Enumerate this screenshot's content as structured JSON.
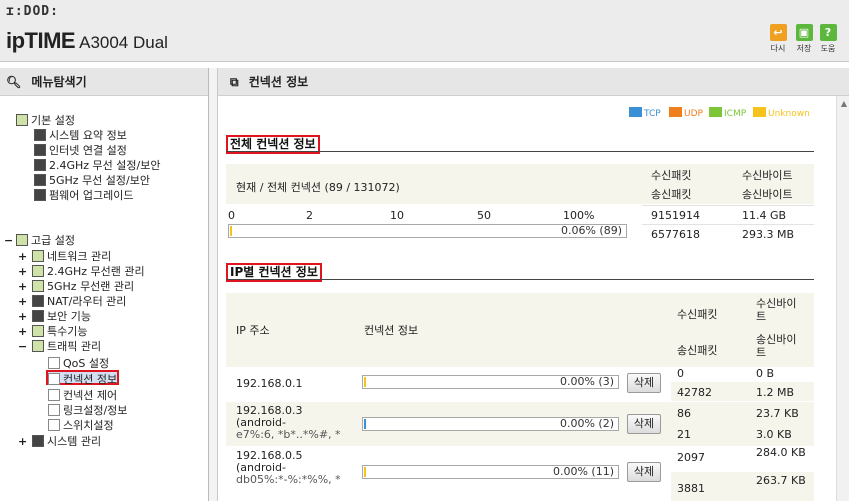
{
  "header": {
    "brand_logo": "ɪ:DOD:",
    "brand": "ipTIME",
    "model": "A3004 Dual",
    "tools": [
      {
        "label": "다시",
        "icon": "refresh-icon",
        "color": "#f0a020"
      },
      {
        "label": "저장",
        "icon": "save-icon",
        "color": "#5cb83c"
      },
      {
        "label": "도움",
        "icon": "help-icon",
        "color": "#5cb83c"
      }
    ]
  },
  "left_panel": {
    "title": "메뉴탐색기",
    "basic": {
      "title": "기본 설정",
      "items": [
        "시스템 요약 정보",
        "인터넷 연결 설정",
        "2.4GHz 무선 설정/보안",
        "5GHz 무선 설정/보안",
        "펌웨어 업그레이드"
      ]
    },
    "advanced": {
      "title": "고급 설정",
      "items": [
        "네트워크 관리",
        "2.4GHz 무선랜 관리",
        "5GHz 무선랜 관리",
        "NAT/라우터 관리",
        "보안 기능",
        "특수기능",
        "트래픽 관리"
      ],
      "traffic_children": [
        "QoS 설정",
        "컨넥션 정보",
        "컨넥션 제어",
        "링크설정/정보",
        "스위치설정"
      ],
      "system": "시스템 관리"
    }
  },
  "main": {
    "title": "컨넥션 정보",
    "legend": [
      {
        "label": "TCP",
        "color": "#3b8fd6"
      },
      {
        "label": "UDP",
        "color": "#f07f1d"
      },
      {
        "label": "ICMP",
        "color": "#7cc63a"
      },
      {
        "label": "Unknown",
        "color": "#f5c31c"
      }
    ],
    "total": {
      "section_title": "전체 컨넥션 정보",
      "current_label": "현재 / 전체 컨넥션 (89 / 131072)",
      "scale": [
        "0",
        "2",
        "10",
        "50",
        "100%"
      ],
      "bar_text": "0.06% (89)",
      "bar_fraction": 0.0006,
      "rx_packets_label": "수신패킷",
      "tx_packets_label": "송신패킷",
      "rx_bytes_label": "수신바이트",
      "tx_bytes_label": "송신바이트",
      "rx_packets": "9151914",
      "rx_bytes": "11.4 GB",
      "tx_packets": "6577618",
      "tx_bytes": "293.3 MB"
    },
    "per_ip": {
      "section_title": "IP별 컨넥션 정보",
      "col_ip": "IP 주소",
      "col_conn": "컨넥션 정보",
      "col_rx_packets": "수신패킷",
      "col_tx_packets": "송신패킷",
      "col_rx_bytes": "수신바이트",
      "col_tx_bytes": "송신바이트",
      "delete_label": "삭제",
      "rows": [
        {
          "ip": "192.168.0.1",
          "host": "",
          "mac": "",
          "bar_text": "0.00% (3)",
          "bar_color": "#f5c31c",
          "rx_packets": "0",
          "rx_bytes": "0 B",
          "tx_packets": "42782",
          "tx_bytes": "1.2 MB"
        },
        {
          "ip": "192.168.0.3",
          "host": "(android-",
          "mac": "e7%:6, *b*..*%#, *",
          "bar_text": "0.00% (2)",
          "bar_color": "#3b8fd6",
          "rx_packets": "86",
          "rx_bytes": "23.7 KB",
          "tx_packets": "21",
          "tx_bytes": "3.0 KB"
        },
        {
          "ip": "192.168.0.5",
          "host": "(android-",
          "mac": "db05%:*-%:*%%, *",
          "bar_text": "0.00% (11)",
          "bar_color": "#f5c31c",
          "rx_packets": "2097",
          "rx_bytes": "284.0 KB",
          "tx_packets": "3881",
          "tx_bytes": "263.7 KB"
        }
      ]
    }
  }
}
